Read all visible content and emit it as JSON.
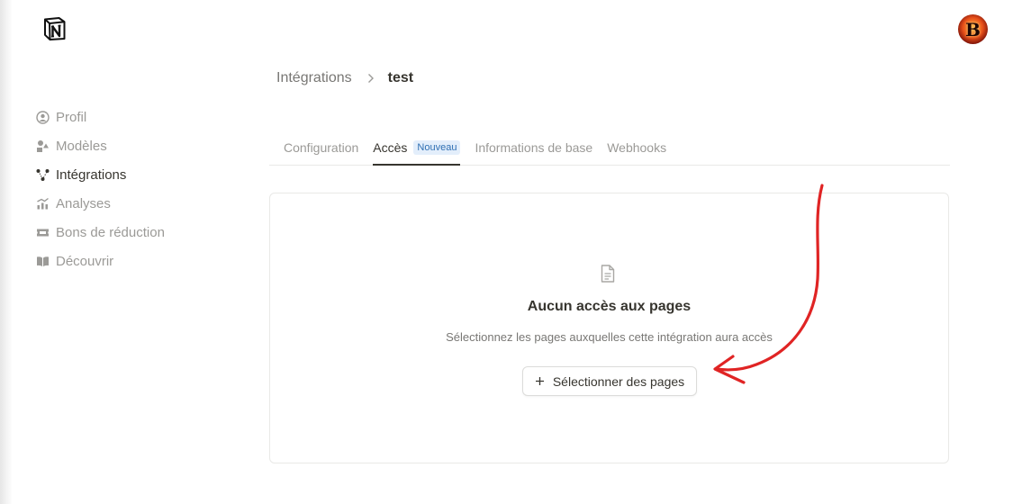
{
  "breadcrumb": {
    "parent": "Intégrations",
    "current": "test"
  },
  "sidebar": {
    "items": [
      {
        "label": "Profil",
        "icon": "profile-icon",
        "active": false
      },
      {
        "label": "Modèles",
        "icon": "templates-icon",
        "active": false
      },
      {
        "label": "Intégrations",
        "icon": "integrations-icon",
        "active": true
      },
      {
        "label": "Analyses",
        "icon": "analytics-icon",
        "active": false
      },
      {
        "label": "Bons de réduction",
        "icon": "coupon-icon",
        "active": false
      },
      {
        "label": "Découvrir",
        "icon": "discover-icon",
        "active": false
      }
    ]
  },
  "tabs": [
    {
      "label": "Configuration",
      "active": false
    },
    {
      "label": "Accès",
      "active": true,
      "badge": "Nouveau"
    },
    {
      "label": "Informations de base",
      "active": false
    },
    {
      "label": "Webhooks",
      "active": false
    }
  ],
  "empty_state": {
    "icon": "document-icon",
    "title": "Aucun accès aux pages",
    "subtitle": "Sélectionnez les pages auxquelles cette intégration aura accès",
    "button_label": "Sélectionner des pages"
  },
  "avatar": {
    "letter": "B"
  },
  "colors": {
    "annotation_arrow": "#e02424",
    "badge_bg": "#e3eefb",
    "badge_text": "#2f6fb3"
  }
}
